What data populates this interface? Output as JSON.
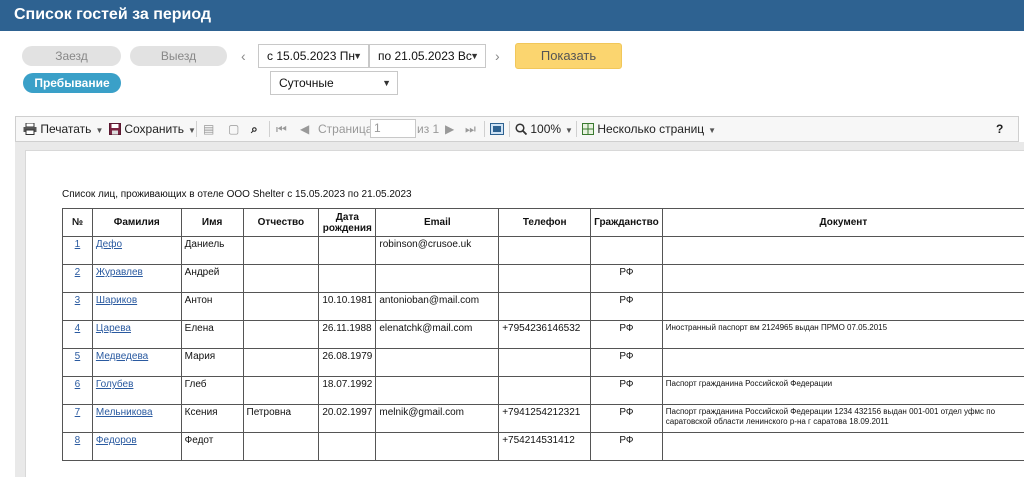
{
  "header": {
    "title": "Список гостей за период"
  },
  "filters": {
    "checkin_label": "Заезд",
    "checkout_label": "Выезд",
    "stay_label": "Пребывание",
    "date_from": "с 15.05.2023 Пн",
    "date_to": "по 21.05.2023 Вс",
    "show_label": "Показать",
    "period_type": "Суточные"
  },
  "toolbar": {
    "print_label": "Печатать",
    "save_label": "Сохранить",
    "page_label": "Страница",
    "page_value": "1",
    "page_of": "из 1",
    "zoom": "100%",
    "multi_page_label": "Несколько страниц",
    "help_label": "?"
  },
  "report": {
    "title": "Список лиц, проживающих в отеле ООО Shelter с 15.05.2023 по 21.05.2023",
    "columns": [
      "№",
      "Фамилия",
      "Имя",
      "Отчество",
      "Дата рождения",
      "Email",
      "Телефон",
      "Гражданство",
      "Документ"
    ],
    "rows": [
      {
        "n": "1",
        "surname": "Дефо",
        "name": "Даниель",
        "patronymic": "",
        "birth": "",
        "email": "robinson@crusoe.uk",
        "phone": "",
        "citizenship": "",
        "document": ""
      },
      {
        "n": "2",
        "surname": "Журавлев",
        "name": "Андрей",
        "patronymic": "",
        "birth": "",
        "email": "",
        "phone": "",
        "citizenship": "РФ",
        "document": ""
      },
      {
        "n": "3",
        "surname": "Шариков",
        "name": "Антон",
        "patronymic": "",
        "birth": "10.10.1981",
        "email": "antonioban@mail.com",
        "phone": "",
        "citizenship": "РФ",
        "document": ""
      },
      {
        "n": "4",
        "surname": "Царева",
        "name": "Елена",
        "patronymic": "",
        "birth": "26.11.1988",
        "email": "elenatchk@mail.com",
        "phone": "+7954236146532",
        "citizenship": "РФ",
        "document": "Иностранный паспорт вм 2124965 выдан ПРМО 07.05.2015"
      },
      {
        "n": "5",
        "surname": "Медведева",
        "name": "Мария",
        "patronymic": "",
        "birth": "26.08.1979",
        "email": "",
        "phone": "",
        "citizenship": "РФ",
        "document": ""
      },
      {
        "n": "6",
        "surname": "Голубев",
        "name": "Глеб",
        "patronymic": "",
        "birth": "18.07.1992",
        "email": "",
        "phone": "",
        "citizenship": "РФ",
        "document": "Паспорт гражданина Российской Федерации"
      },
      {
        "n": "7",
        "surname": "Мельникова",
        "name": "Ксения",
        "patronymic": "Петровна",
        "birth": "20.02.1997",
        "email": "melnik@gmail.com",
        "phone": "+7941254212321",
        "citizenship": "РФ",
        "document": "Паспорт гражданина Российской Федерации 1234 432156 выдан 001-001 отдел уфмс по саратовской области ленинского р-на г саратова 18.09.2011"
      },
      {
        "n": "8",
        "surname": "Федоров",
        "name": "Федот",
        "patronymic": "",
        "birth": "",
        "email": "",
        "phone": "+754214531412",
        "citizenship": "РФ",
        "document": ""
      }
    ]
  }
}
